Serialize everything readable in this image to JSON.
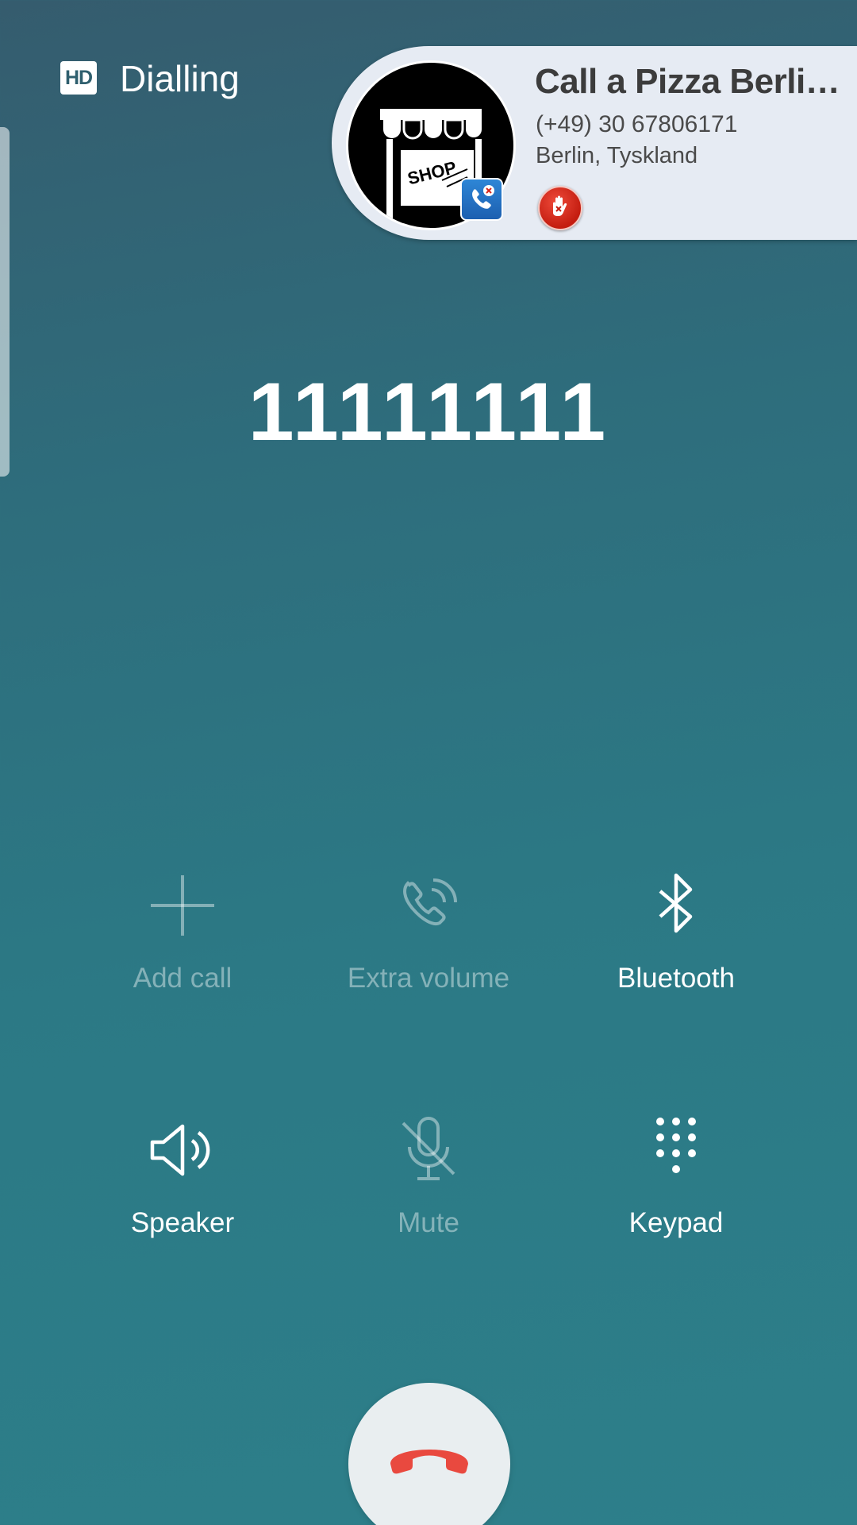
{
  "header": {
    "hd_badge": "HD",
    "status": "Dialling"
  },
  "caller_id": {
    "name": "Call a Pizza Berli…",
    "number": "(+49) 30 67806171",
    "location": "Berlin, Tyskland",
    "avatar_text": "SHOP",
    "avatar_icon": "shop-icon",
    "badge_icon": "call-blocker-app-icon",
    "action_icon": "block-hand-icon"
  },
  "dialed_number": "11111111",
  "controls": [
    {
      "label": "Add call",
      "icon": "add-call-icon",
      "enabled": false
    },
    {
      "label": "Extra volume",
      "icon": "extra-volume-icon",
      "enabled": false
    },
    {
      "label": "Bluetooth",
      "icon": "bluetooth-icon",
      "enabled": true
    },
    {
      "label": "Speaker",
      "icon": "speaker-icon",
      "enabled": true
    },
    {
      "label": "Mute",
      "icon": "mute-icon",
      "enabled": false
    },
    {
      "label": "Keypad",
      "icon": "keypad-icon",
      "enabled": true
    }
  ],
  "end_call": {
    "icon": "end-call-icon",
    "color": "#e9493f"
  },
  "colors": {
    "background_top": "#355c6e",
    "background_bottom": "#2d7f8a",
    "card_background": "#e6ebf3"
  }
}
